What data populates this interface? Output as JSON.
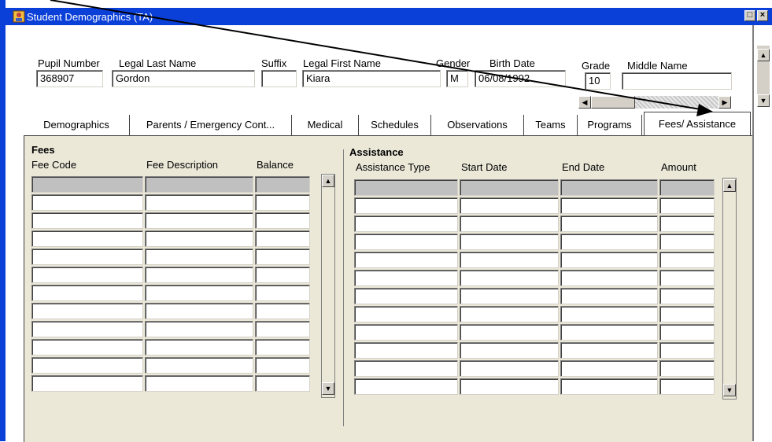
{
  "window": {
    "title": "Student Demographics (TA)",
    "restore_glyph": "□",
    "close_glyph": "×"
  },
  "header": {
    "labels": {
      "pupil_number": "Pupil Number",
      "legal_last_name": "Legal Last Name",
      "suffix": "Suffix",
      "legal_first_name": "Legal First Name",
      "gender": "Gender",
      "birth_date": "Birth Date",
      "grade": "Grade",
      "middle_name": "Middle Name"
    },
    "values": {
      "pupil_number": "368907",
      "legal_last_name": "Gordon",
      "suffix": "",
      "legal_first_name": "Kiara",
      "gender": "M",
      "birth_date": "06/08/1992",
      "grade": "10",
      "middle_name": ""
    }
  },
  "tabs": [
    "Demographics",
    "Parents / Emergency Cont...",
    "Medical",
    "Schedules",
    "Observations",
    "Teams",
    "Programs",
    "Fees/ Assistance"
  ],
  "active_tab": "Fees/ Assistance",
  "fees": {
    "title": "Fees",
    "columns": [
      "Fee Code",
      "Fee Description",
      "Balance"
    ]
  },
  "assistance": {
    "title": "Assistance",
    "columns": [
      "Assistance Type",
      "Start Date",
      "End Date",
      "Amount"
    ]
  },
  "icons": {
    "scroll_up": "▲",
    "scroll_down": "▼",
    "scroll_left": "◀",
    "scroll_right": "▶"
  },
  "colors": {
    "titlebar": "#0a3fd8",
    "panel": "#ebe8d8",
    "current_row": "#c0c0c0",
    "annotation_arrow": "#000000"
  }
}
